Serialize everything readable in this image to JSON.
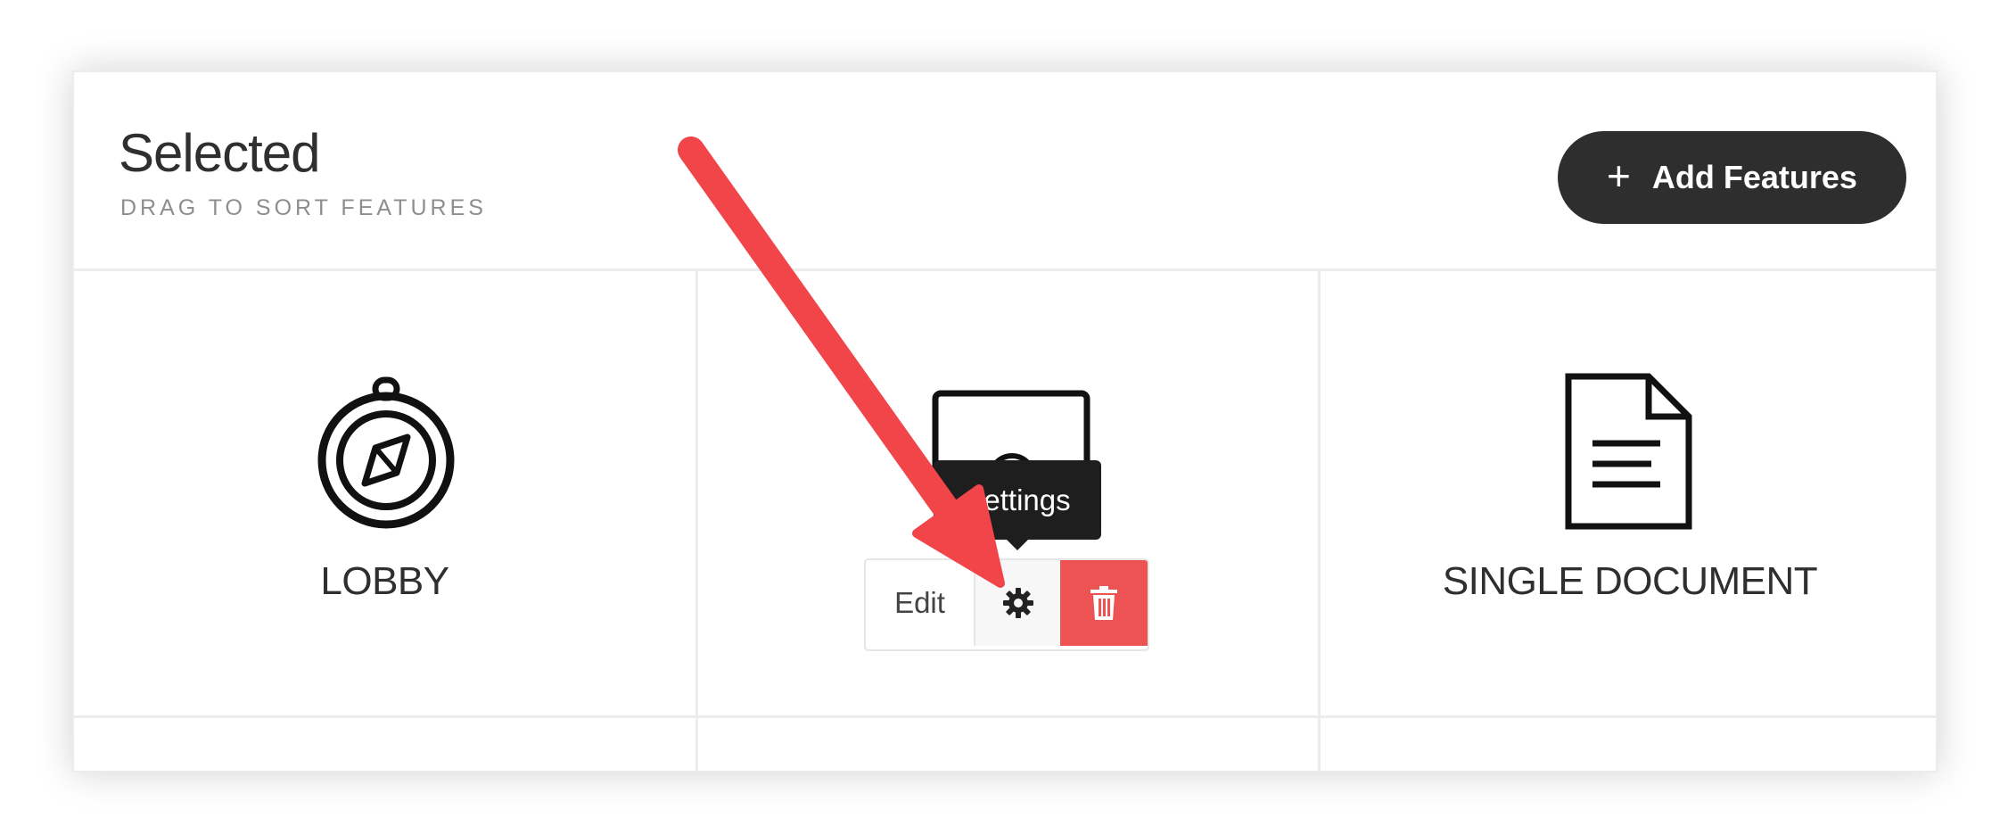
{
  "header": {
    "title": "Selected",
    "subtitle": "DRAG TO SORT FEATURES",
    "add_button_label": "Add Features",
    "add_button_icon": "plus-icon"
  },
  "features": [
    {
      "label": "LOBBY",
      "icon": "compass-icon"
    },
    {
      "label": "",
      "icon": "monitor-icon"
    },
    {
      "label": "SINGLE DOCUMENT",
      "icon": "document-icon"
    }
  ],
  "actions": {
    "edit_label": "Edit",
    "settings_icon": "gear-icon",
    "delete_icon": "trash-icon",
    "tooltip": "Settings"
  },
  "colors": {
    "add_button_bg": "#2e2e2e",
    "delete_bg": "#ec5352",
    "annotation_arrow": "#f2454a",
    "tooltip_bg": "#1e1e1e"
  }
}
